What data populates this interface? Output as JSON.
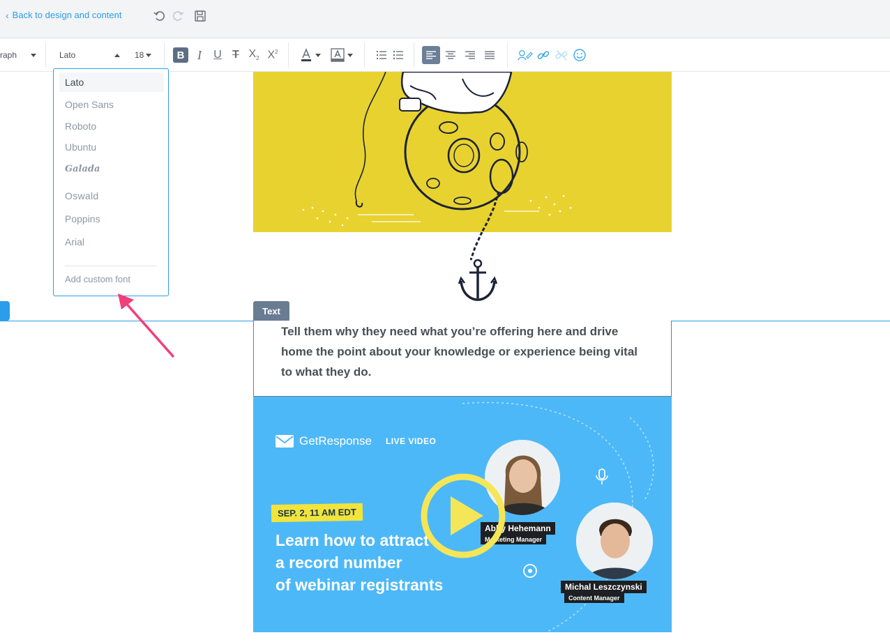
{
  "topbar": {
    "back_label": "Back to design and content"
  },
  "toolbar": {
    "paragraph_label": "raph",
    "font_label": "Lato",
    "size_label": "18"
  },
  "font_menu": {
    "items": [
      "Lato",
      "Open Sans",
      "Roboto",
      "Ubuntu",
      "Galada",
      "Oswald",
      "Poppins",
      "Arial"
    ],
    "selected": "Lato",
    "add_custom": "Add custom font"
  },
  "canvas": {
    "text_tag": "Text",
    "body_text": "Tell them why they need what you’re offering here and drive home the point about your knowledge or experience being vital to what they do.",
    "video": {
      "brand": "GetResponse",
      "badge": "LIVE VIDEO",
      "date": "SEP. 2, 11 AM EDT",
      "headline_1": "Learn how to attract",
      "headline_2": "a record number",
      "headline_3": "of webinar registrants",
      "speaker1_name": "Abby Hehemann",
      "speaker1_role": "Marketing Manager",
      "speaker2_name": "Michal Leszczynski",
      "speaker2_role": "Content Manager"
    }
  },
  "colors": {
    "accent": "#2b9de9",
    "hero_yellow": "#e8d22f",
    "video_blue": "#4db8f7",
    "arrow_pink": "#f23e7a"
  }
}
